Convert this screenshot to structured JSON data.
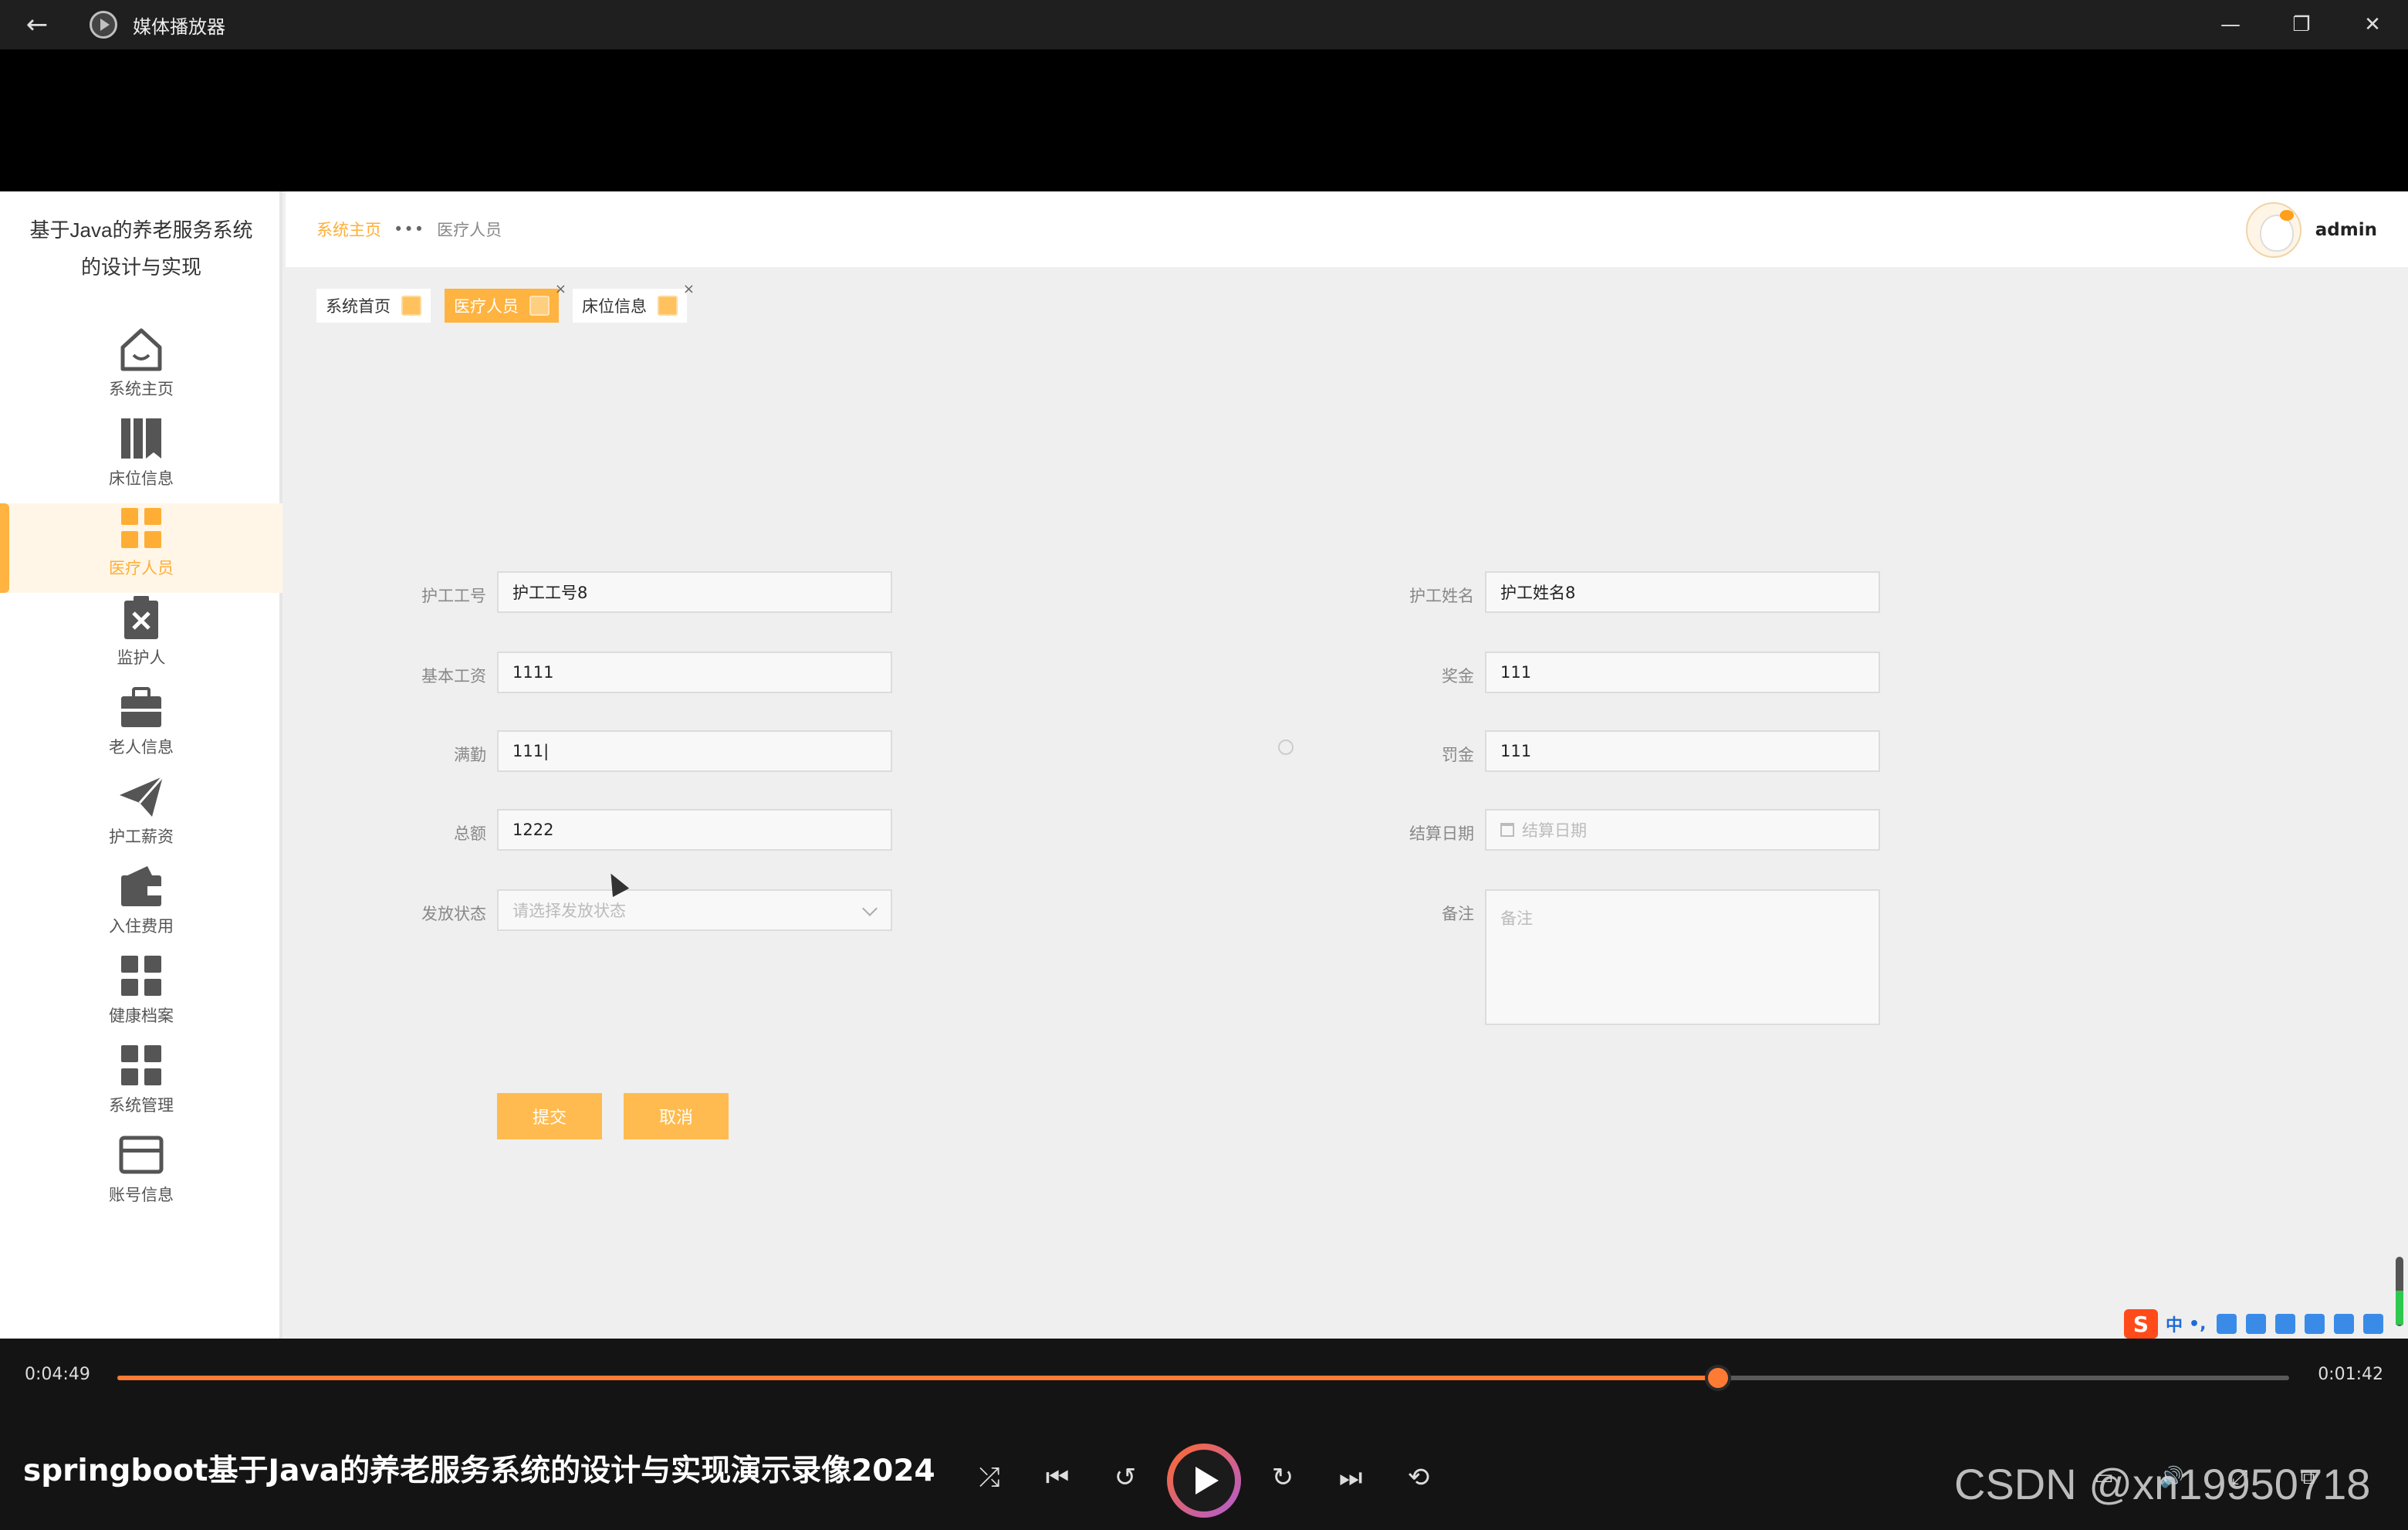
{
  "window": {
    "title": "媒体播放器",
    "back_glyph": "←",
    "controls": [
      "—",
      "❐",
      "✕"
    ]
  },
  "app": {
    "system_title_line1": "基于Java的养老服务系统",
    "system_title_line2": "的设计与实现",
    "menu": [
      {
        "label": "系统主页",
        "icon": "home-icon"
      },
      {
        "label": "床位信息",
        "icon": "books-icon"
      },
      {
        "label": "医疗人员",
        "icon": "grid-icon",
        "active": true
      },
      {
        "label": "监护人",
        "icon": "clipboard-x-icon"
      },
      {
        "label": "老人信息",
        "icon": "briefcase-icon"
      },
      {
        "label": "护工薪资",
        "icon": "paper-plane-icon"
      },
      {
        "label": "入住费用",
        "icon": "wallet-icon"
      },
      {
        "label": "健康档案",
        "icon": "grid-icon"
      },
      {
        "label": "系统管理",
        "icon": "grid-icon"
      },
      {
        "label": "账号信息",
        "icon": "card-icon"
      }
    ],
    "breadcrumb": {
      "home": "系统主页",
      "separator": "•••",
      "current": "医疗人员"
    },
    "user": {
      "name": "admin"
    },
    "tags": [
      {
        "label": "系统首页",
        "active": false,
        "closable": false
      },
      {
        "label": "医疗人员",
        "active": true,
        "closable": true
      },
      {
        "label": "床位信息",
        "active": false,
        "closable": true
      }
    ],
    "tag_close_glyph": "×",
    "form": {
      "worker_id": {
        "label": "护工工号",
        "value": "护工工号8"
      },
      "worker_name": {
        "label": "护工姓名",
        "value": "护工姓名8"
      },
      "base_salary": {
        "label": "基本工资",
        "value": "1111"
      },
      "bonus": {
        "label": "奖金",
        "value": "111"
      },
      "full_attendance": {
        "label": "满勤",
        "value": "111|"
      },
      "fine": {
        "label": "罚金",
        "value": "111"
      },
      "total": {
        "label": "总额",
        "value": "1222"
      },
      "settle_date": {
        "label": "结算日期",
        "placeholder": "结算日期"
      },
      "pay_status": {
        "label": "发放状态",
        "placeholder": "请选择发放状态"
      },
      "remark": {
        "label": "备注",
        "placeholder": "备注"
      },
      "submit_label": "提交",
      "cancel_label": "取消"
    },
    "ime": {
      "logo": "S",
      "mode": "中",
      "punct": "•,"
    }
  },
  "player": {
    "elapsed": "0:04:49",
    "remaining": "0:01:42",
    "progress_fraction": 0.737,
    "video_title": "springboot基于Java的养老服务系统的设计与实现演示录像2024",
    "controls": {
      "shuffle": "⤮",
      "prev": "⏮",
      "back10": "↺",
      "forward30": "↻",
      "next": "⏭",
      "repeat": "⟲",
      "subtitles": "▭",
      "volume": "🔊",
      "fullscreen": "⤢",
      "miniplayer": "⧉"
    },
    "watermark": "CSDN @xn19950718"
  },
  "colors": {
    "accent": "#ffb340",
    "progress": "#ff7a33"
  }
}
